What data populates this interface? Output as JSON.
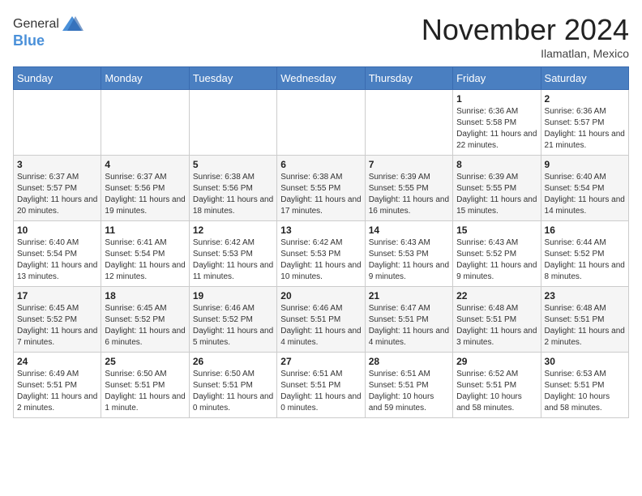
{
  "header": {
    "logo_line1": "General",
    "logo_line2": "Blue",
    "month_title": "November 2024",
    "location": "Ilamatlan, Mexico"
  },
  "weekdays": [
    "Sunday",
    "Monday",
    "Tuesday",
    "Wednesday",
    "Thursday",
    "Friday",
    "Saturday"
  ],
  "weeks": [
    [
      {
        "day": "",
        "sunrise": "",
        "sunset": "",
        "daylight": ""
      },
      {
        "day": "",
        "sunrise": "",
        "sunset": "",
        "daylight": ""
      },
      {
        "day": "",
        "sunrise": "",
        "sunset": "",
        "daylight": ""
      },
      {
        "day": "",
        "sunrise": "",
        "sunset": "",
        "daylight": ""
      },
      {
        "day": "",
        "sunrise": "",
        "sunset": "",
        "daylight": ""
      },
      {
        "day": "1",
        "sunrise": "Sunrise: 6:36 AM",
        "sunset": "Sunset: 5:58 PM",
        "daylight": "Daylight: 11 hours and 22 minutes."
      },
      {
        "day": "2",
        "sunrise": "Sunrise: 6:36 AM",
        "sunset": "Sunset: 5:57 PM",
        "daylight": "Daylight: 11 hours and 21 minutes."
      }
    ],
    [
      {
        "day": "3",
        "sunrise": "Sunrise: 6:37 AM",
        "sunset": "Sunset: 5:57 PM",
        "daylight": "Daylight: 11 hours and 20 minutes."
      },
      {
        "day": "4",
        "sunrise": "Sunrise: 6:37 AM",
        "sunset": "Sunset: 5:56 PM",
        "daylight": "Daylight: 11 hours and 19 minutes."
      },
      {
        "day": "5",
        "sunrise": "Sunrise: 6:38 AM",
        "sunset": "Sunset: 5:56 PM",
        "daylight": "Daylight: 11 hours and 18 minutes."
      },
      {
        "day": "6",
        "sunrise": "Sunrise: 6:38 AM",
        "sunset": "Sunset: 5:55 PM",
        "daylight": "Daylight: 11 hours and 17 minutes."
      },
      {
        "day": "7",
        "sunrise": "Sunrise: 6:39 AM",
        "sunset": "Sunset: 5:55 PM",
        "daylight": "Daylight: 11 hours and 16 minutes."
      },
      {
        "day": "8",
        "sunrise": "Sunrise: 6:39 AM",
        "sunset": "Sunset: 5:55 PM",
        "daylight": "Daylight: 11 hours and 15 minutes."
      },
      {
        "day": "9",
        "sunrise": "Sunrise: 6:40 AM",
        "sunset": "Sunset: 5:54 PM",
        "daylight": "Daylight: 11 hours and 14 minutes."
      }
    ],
    [
      {
        "day": "10",
        "sunrise": "Sunrise: 6:40 AM",
        "sunset": "Sunset: 5:54 PM",
        "daylight": "Daylight: 11 hours and 13 minutes."
      },
      {
        "day": "11",
        "sunrise": "Sunrise: 6:41 AM",
        "sunset": "Sunset: 5:54 PM",
        "daylight": "Daylight: 11 hours and 12 minutes."
      },
      {
        "day": "12",
        "sunrise": "Sunrise: 6:42 AM",
        "sunset": "Sunset: 5:53 PM",
        "daylight": "Daylight: 11 hours and 11 minutes."
      },
      {
        "day": "13",
        "sunrise": "Sunrise: 6:42 AM",
        "sunset": "Sunset: 5:53 PM",
        "daylight": "Daylight: 11 hours and 10 minutes."
      },
      {
        "day": "14",
        "sunrise": "Sunrise: 6:43 AM",
        "sunset": "Sunset: 5:53 PM",
        "daylight": "Daylight: 11 hours and 9 minutes."
      },
      {
        "day": "15",
        "sunrise": "Sunrise: 6:43 AM",
        "sunset": "Sunset: 5:52 PM",
        "daylight": "Daylight: 11 hours and 9 minutes."
      },
      {
        "day": "16",
        "sunrise": "Sunrise: 6:44 AM",
        "sunset": "Sunset: 5:52 PM",
        "daylight": "Daylight: 11 hours and 8 minutes."
      }
    ],
    [
      {
        "day": "17",
        "sunrise": "Sunrise: 6:45 AM",
        "sunset": "Sunset: 5:52 PM",
        "daylight": "Daylight: 11 hours and 7 minutes."
      },
      {
        "day": "18",
        "sunrise": "Sunrise: 6:45 AM",
        "sunset": "Sunset: 5:52 PM",
        "daylight": "Daylight: 11 hours and 6 minutes."
      },
      {
        "day": "19",
        "sunrise": "Sunrise: 6:46 AM",
        "sunset": "Sunset: 5:52 PM",
        "daylight": "Daylight: 11 hours and 5 minutes."
      },
      {
        "day": "20",
        "sunrise": "Sunrise: 6:46 AM",
        "sunset": "Sunset: 5:51 PM",
        "daylight": "Daylight: 11 hours and 4 minutes."
      },
      {
        "day": "21",
        "sunrise": "Sunrise: 6:47 AM",
        "sunset": "Sunset: 5:51 PM",
        "daylight": "Daylight: 11 hours and 4 minutes."
      },
      {
        "day": "22",
        "sunrise": "Sunrise: 6:48 AM",
        "sunset": "Sunset: 5:51 PM",
        "daylight": "Daylight: 11 hours and 3 minutes."
      },
      {
        "day": "23",
        "sunrise": "Sunrise: 6:48 AM",
        "sunset": "Sunset: 5:51 PM",
        "daylight": "Daylight: 11 hours and 2 minutes."
      }
    ],
    [
      {
        "day": "24",
        "sunrise": "Sunrise: 6:49 AM",
        "sunset": "Sunset: 5:51 PM",
        "daylight": "Daylight: 11 hours and 2 minutes."
      },
      {
        "day": "25",
        "sunrise": "Sunrise: 6:50 AM",
        "sunset": "Sunset: 5:51 PM",
        "daylight": "Daylight: 11 hours and 1 minute."
      },
      {
        "day": "26",
        "sunrise": "Sunrise: 6:50 AM",
        "sunset": "Sunset: 5:51 PM",
        "daylight": "Daylight: 11 hours and 0 minutes."
      },
      {
        "day": "27",
        "sunrise": "Sunrise: 6:51 AM",
        "sunset": "Sunset: 5:51 PM",
        "daylight": "Daylight: 11 hours and 0 minutes."
      },
      {
        "day": "28",
        "sunrise": "Sunrise: 6:51 AM",
        "sunset": "Sunset: 5:51 PM",
        "daylight": "Daylight: 10 hours and 59 minutes."
      },
      {
        "day": "29",
        "sunrise": "Sunrise: 6:52 AM",
        "sunset": "Sunset: 5:51 PM",
        "daylight": "Daylight: 10 hours and 58 minutes."
      },
      {
        "day": "30",
        "sunrise": "Sunrise: 6:53 AM",
        "sunset": "Sunset: 5:51 PM",
        "daylight": "Daylight: 10 hours and 58 minutes."
      }
    ]
  ]
}
